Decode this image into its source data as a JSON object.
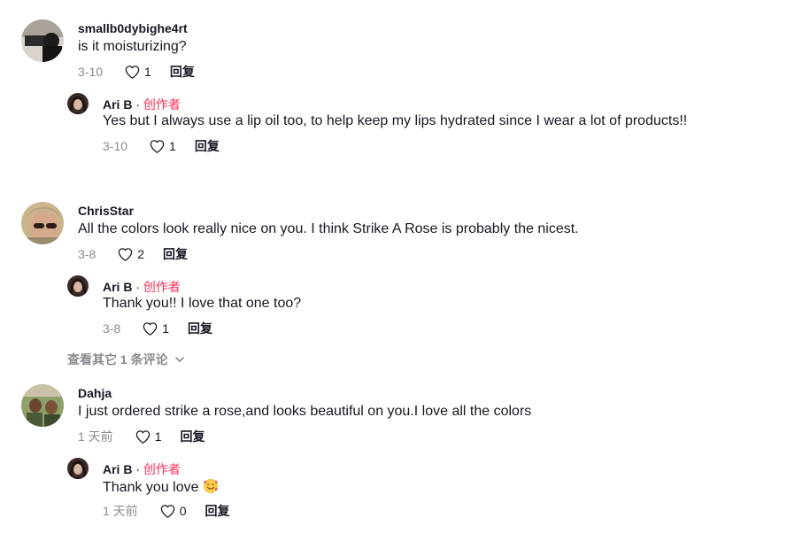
{
  "threads": [
    {
      "comment": {
        "username": "smallb0dybighe4rt",
        "text": "is it moisturizing?",
        "time": "3-10",
        "likes": "1",
        "reply_label": "回复"
      },
      "reply": {
        "username": "Ari B",
        "separator": " · ",
        "creator_label": "创作者",
        "text": "Yes but I always use a lip oil too, to help keep my lips hydrated since I wear a lot of products!!",
        "time": "3-10",
        "likes": "1",
        "reply_label": "回复"
      }
    },
    {
      "comment": {
        "username": "ChrisStar",
        "text": "All the colors look really nice on you. I think Strike A Rose is probably the nicest.",
        "time": "3-8",
        "likes": "2",
        "reply_label": "回复"
      },
      "reply": {
        "username": "Ari B",
        "separator": " · ",
        "creator_label": "创作者",
        "text": "Thank you!! I love that one too?",
        "time": "3-8",
        "likes": "1",
        "reply_label": "回复"
      },
      "more_replies": "查看其它 1 条评论"
    },
    {
      "comment": {
        "username": "Dahja",
        "text": "I just ordered strike a rose,and looks beautiful on you.I love all the colors",
        "time": "1 天前",
        "likes": "1",
        "reply_label": "回复"
      },
      "reply": {
        "username": "Ari B",
        "separator": " · ",
        "creator_label": "创作者",
        "text": "Thank you love",
        "time": "1 天前",
        "likes": "0",
        "reply_label": "回复"
      }
    }
  ],
  "colors": {
    "creator": "#fe2c55",
    "muted": "#8a8b91",
    "text": "#161823"
  }
}
